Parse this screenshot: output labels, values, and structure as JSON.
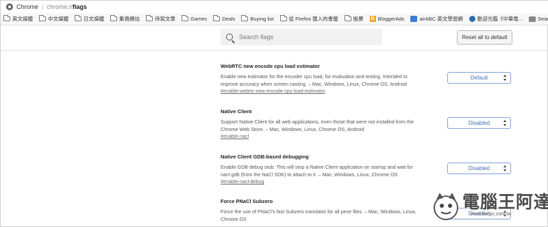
{
  "browser": {
    "site_label": "Chrome",
    "url_scheme": "chrome://",
    "url_path": "flags"
  },
  "bookmarks": [
    {
      "label": "英文媒體",
      "icon": "folder-icon"
    },
    {
      "label": "中文媒體",
      "icon": "folder-icon"
    },
    {
      "label": "日文媒體",
      "icon": "folder-icon"
    },
    {
      "label": "集資網站",
      "icon": "folder-icon"
    },
    {
      "label": "待寫文章",
      "icon": "folder-icon"
    },
    {
      "label": "Games",
      "icon": "folder-icon"
    },
    {
      "label": "Deals",
      "icon": "folder-icon"
    },
    {
      "label": "Buying list",
      "icon": "folder-icon"
    },
    {
      "label": "從 Firefox 匯入的書籤",
      "icon": "folder-icon"
    },
    {
      "label": "股票",
      "icon": "folder-icon"
    },
    {
      "label": "BloggerAds",
      "icon": "bloggerads-icon"
    },
    {
      "label": "airABC 英文學習網",
      "icon": "airabc-icon"
    },
    {
      "label": "歡迎光臨《中華電...",
      "icon": "globe-icon"
    },
    {
      "label": "Sear",
      "icon": "gift-icon"
    }
  ],
  "search": {
    "placeholder": "Search flags",
    "value": ""
  },
  "reset_button": {
    "label": "Reset all to default"
  },
  "flags": [
    {
      "title": "WebRTC new encode cpu load estimator",
      "description_lines": [
        "Enable new estimator for the encoder cpu load, for evaluation and testing. Intended to",
        "improve accuracy when screen casting. – Mac, Windows, Linux, Chrome OS, Android"
      ],
      "link": "#enable-webrtc-new-encode-cpu-load-estimator",
      "selected": "Default"
    },
    {
      "title": "Native Client",
      "description_lines": [
        "Support Native Client for all web applications, even those that were not installed from the",
        "Chrome Web Store. – Mac, Windows, Linux, Chrome OS, Android"
      ],
      "link": "#enable-nacl",
      "selected": "Disabled"
    },
    {
      "title": "Native Client GDB-based debugging",
      "description_lines": [
        "Enable GDB debug stub. This will stop a Native Client application on startup and wait for",
        "nacl-gdb (from the NaCl SDK) to attach to it. – Mac, Windows, Linux, Chrome OS"
      ],
      "link": "#enable-nacl-debug",
      "selected": "Disabled"
    },
    {
      "title": "Force PNaCl Subzero",
      "description_lines": [
        "Force the use of PNaCl's fast Subzero translator for all pexe files. – Mac, Windows, Linux,",
        "Chrome OS"
      ],
      "link": "",
      "selected": "Disabled"
    }
  ],
  "watermark": {
    "text": "電腦王阿達",
    "url": "www.kocpc.com.tw"
  },
  "colors": {
    "select_border": "#7f9fd8",
    "select_text": "#4a6fb5",
    "bookmarks_bg": "#f7f7f7"
  }
}
